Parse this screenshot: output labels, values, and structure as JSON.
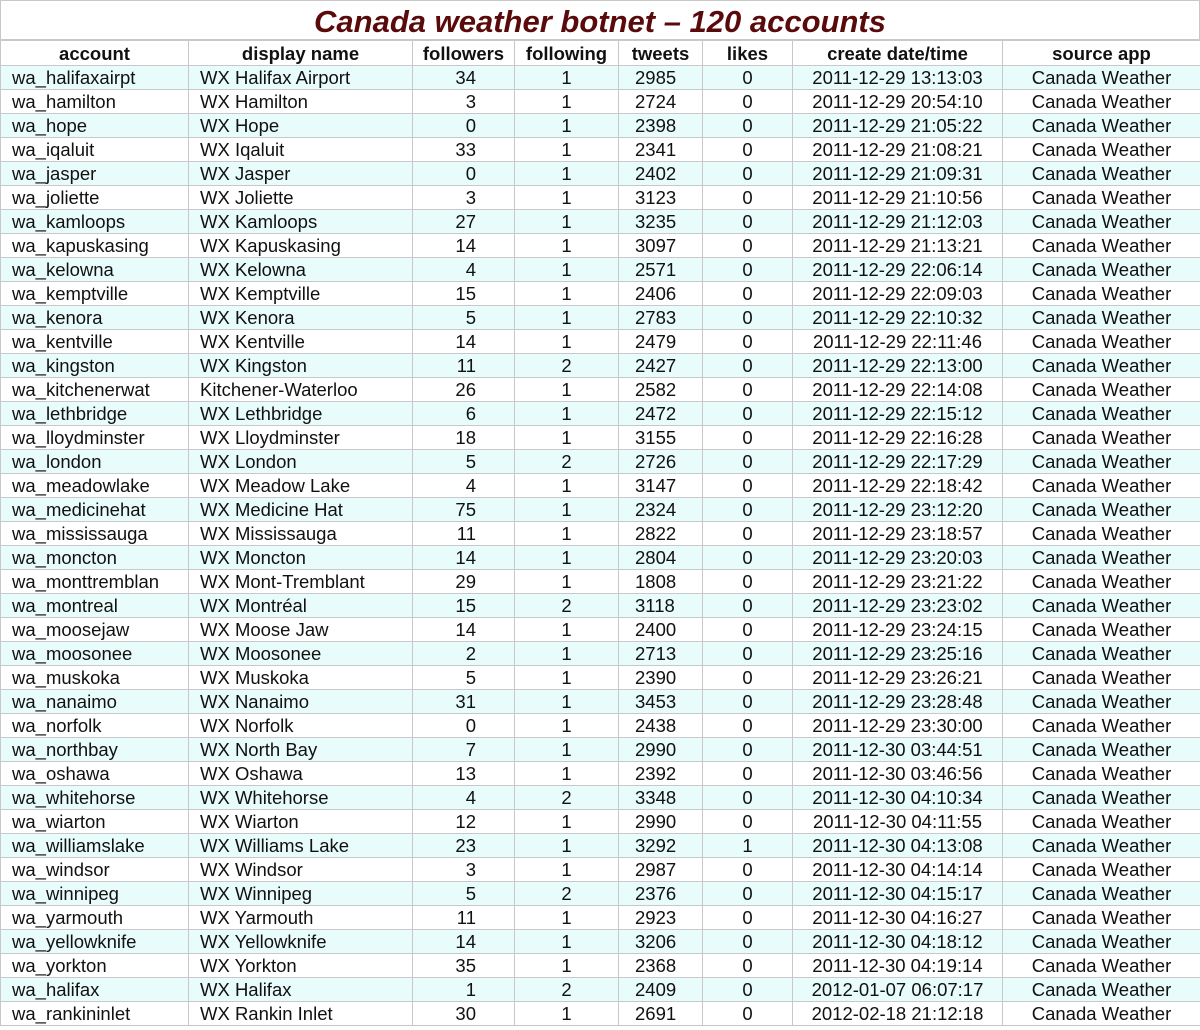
{
  "title": "Canada weather botnet – 120 accounts",
  "columns": [
    "account",
    "display name",
    "followers",
    "following",
    "tweets",
    "likes",
    "create date/time",
    "source app"
  ],
  "rows": [
    [
      "wa_halifaxairpt",
      "WX Halifax Airport",
      "34",
      "1",
      "2985",
      "0",
      "2011-12-29 13:13:03",
      "Canada Weather"
    ],
    [
      "wa_hamilton",
      "WX Hamilton",
      "3",
      "1",
      "2724",
      "0",
      "2011-12-29 20:54:10",
      "Canada Weather"
    ],
    [
      "wa_hope",
      "WX Hope",
      "0",
      "1",
      "2398",
      "0",
      "2011-12-29 21:05:22",
      "Canada Weather"
    ],
    [
      "wa_iqaluit",
      "WX Iqaluit",
      "33",
      "1",
      "2341",
      "0",
      "2011-12-29 21:08:21",
      "Canada Weather"
    ],
    [
      "wa_jasper",
      "WX Jasper",
      "0",
      "1",
      "2402",
      "0",
      "2011-12-29 21:09:31",
      "Canada Weather"
    ],
    [
      "wa_joliette",
      "WX Joliette",
      "3",
      "1",
      "3123",
      "0",
      "2011-12-29 21:10:56",
      "Canada Weather"
    ],
    [
      "wa_kamloops",
      "WX Kamloops",
      "27",
      "1",
      "3235",
      "0",
      "2011-12-29 21:12:03",
      "Canada Weather"
    ],
    [
      "wa_kapuskasing",
      "WX Kapuskasing",
      "14",
      "1",
      "3097",
      "0",
      "2011-12-29 21:13:21",
      "Canada Weather"
    ],
    [
      "wa_kelowna",
      "WX Kelowna",
      "4",
      "1",
      "2571",
      "0",
      "2011-12-29 22:06:14",
      "Canada Weather"
    ],
    [
      "wa_kemptville",
      "WX Kemptville",
      "15",
      "1",
      "2406",
      "0",
      "2011-12-29 22:09:03",
      "Canada Weather"
    ],
    [
      "wa_kenora",
      "WX Kenora",
      "5",
      "1",
      "2783",
      "0",
      "2011-12-29 22:10:32",
      "Canada Weather"
    ],
    [
      "wa_kentville",
      "WX Kentville",
      "14",
      "1",
      "2479",
      "0",
      "2011-12-29 22:11:46",
      "Canada Weather"
    ],
    [
      "wa_kingston",
      "WX Kingston",
      "11",
      "2",
      "2427",
      "0",
      "2011-12-29 22:13:00",
      "Canada Weather"
    ],
    [
      "wa_kitchenerwat",
      "Kitchener-Waterloo",
      "26",
      "1",
      "2582",
      "0",
      "2011-12-29 22:14:08",
      "Canada Weather"
    ],
    [
      "wa_lethbridge",
      "WX Lethbridge",
      "6",
      "1",
      "2472",
      "0",
      "2011-12-29 22:15:12",
      "Canada Weather"
    ],
    [
      "wa_lloydminster",
      "WX Lloydminster",
      "18",
      "1",
      "3155",
      "0",
      "2011-12-29 22:16:28",
      "Canada Weather"
    ],
    [
      "wa_london",
      "WX London",
      "5",
      "2",
      "2726",
      "0",
      "2011-12-29 22:17:29",
      "Canada Weather"
    ],
    [
      "wa_meadowlake",
      "WX Meadow Lake",
      "4",
      "1",
      "3147",
      "0",
      "2011-12-29 22:18:42",
      "Canada Weather"
    ],
    [
      "wa_medicinehat",
      "WX Medicine Hat",
      "75",
      "1",
      "2324",
      "0",
      "2011-12-29 23:12:20",
      "Canada Weather"
    ],
    [
      "wa_mississauga",
      "WX Mississauga",
      "11",
      "1",
      "2822",
      "0",
      "2011-12-29 23:18:57",
      "Canada Weather"
    ],
    [
      "wa_moncton",
      "WX Moncton",
      "14",
      "1",
      "2804",
      "0",
      "2011-12-29 23:20:03",
      "Canada Weather"
    ],
    [
      "wa_monttremblan",
      "WX Mont-Tremblant",
      "29",
      "1",
      "1808",
      "0",
      "2011-12-29 23:21:22",
      "Canada Weather"
    ],
    [
      "wa_montreal",
      "WX Montréal",
      "15",
      "2",
      "3118",
      "0",
      "2011-12-29 23:23:02",
      "Canada Weather"
    ],
    [
      "wa_moosejaw",
      "WX Moose Jaw",
      "14",
      "1",
      "2400",
      "0",
      "2011-12-29 23:24:15",
      "Canada Weather"
    ],
    [
      "wa_moosonee",
      "WX Moosonee",
      "2",
      "1",
      "2713",
      "0",
      "2011-12-29 23:25:16",
      "Canada Weather"
    ],
    [
      "wa_muskoka",
      "WX Muskoka",
      "5",
      "1",
      "2390",
      "0",
      "2011-12-29 23:26:21",
      "Canada Weather"
    ],
    [
      "wa_nanaimo",
      "WX Nanaimo",
      "31",
      "1",
      "3453",
      "0",
      "2011-12-29 23:28:48",
      "Canada Weather"
    ],
    [
      "wa_norfolk",
      "WX Norfolk",
      "0",
      "1",
      "2438",
      "0",
      "2011-12-29 23:30:00",
      "Canada Weather"
    ],
    [
      "wa_northbay",
      "WX North Bay",
      "7",
      "1",
      "2990",
      "0",
      "2011-12-30 03:44:51",
      "Canada Weather"
    ],
    [
      "wa_oshawa",
      "WX Oshawa",
      "13",
      "1",
      "2392",
      "0",
      "2011-12-30 03:46:56",
      "Canada Weather"
    ],
    [
      "wa_whitehorse",
      "WX Whitehorse",
      "4",
      "2",
      "3348",
      "0",
      "2011-12-30 04:10:34",
      "Canada Weather"
    ],
    [
      "wa_wiarton",
      "WX Wiarton",
      "12",
      "1",
      "2990",
      "0",
      "2011-12-30 04:11:55",
      "Canada Weather"
    ],
    [
      "wa_williamslake",
      "WX Williams Lake",
      "23",
      "1",
      "3292",
      "1",
      "2011-12-30 04:13:08",
      "Canada Weather"
    ],
    [
      "wa_windsor",
      "WX Windsor",
      "3",
      "1",
      "2987",
      "0",
      "2011-12-30 04:14:14",
      "Canada Weather"
    ],
    [
      "wa_winnipeg",
      "WX Winnipeg",
      "5",
      "2",
      "2376",
      "0",
      "2011-12-30 04:15:17",
      "Canada Weather"
    ],
    [
      "wa_yarmouth",
      "WX Yarmouth",
      "11",
      "1",
      "2923",
      "0",
      "2011-12-30 04:16:27",
      "Canada Weather"
    ],
    [
      "wa_yellowknife",
      "WX Yellowknife",
      "14",
      "1",
      "3206",
      "0",
      "2011-12-30 04:18:12",
      "Canada Weather"
    ],
    [
      "wa_yorkton",
      "WX Yorkton",
      "35",
      "1",
      "2368",
      "0",
      "2011-12-30 04:19:14",
      "Canada Weather"
    ],
    [
      "wa_halifax",
      "WX Halifax",
      "1",
      "2",
      "2409",
      "0",
      "2012-01-07 06:07:17",
      "Canada Weather"
    ],
    [
      "wa_rankininlet",
      "WX Rankin Inlet",
      "30",
      "1",
      "2691",
      "0",
      "2012-02-18 21:12:18",
      "Canada Weather"
    ]
  ],
  "colors": {
    "title": "#5a0a0a",
    "row_stripe": "#e8fcfc",
    "grid": "#c8c8c8"
  }
}
